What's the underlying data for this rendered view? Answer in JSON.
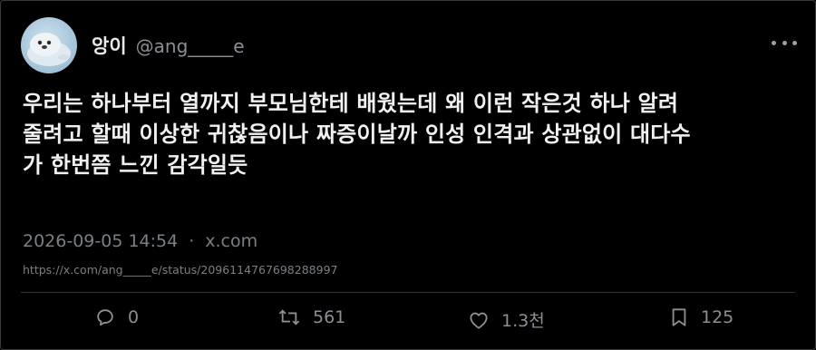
{
  "author": {
    "display_name": "앙이",
    "handle": "@ang_____e"
  },
  "tweet": {
    "lines": [
      "우리는 하나부터 열까지 부모님한테 배웠는데 왜 이런 작은것 하나 알려",
      "줄려고 할때 이상한 귀찮음이나 짜증이날까 인성 인격과 상관없이 대다수",
      "가 한번쯤 느낀 감각일듯"
    ],
    "timestamp": "2026-09-05 14:54",
    "separator": "·",
    "source": "x.com",
    "url": "https://x.com/ang_____e/status/2096114767698288997"
  },
  "actions": {
    "replies": "0",
    "retweets": "561",
    "likes": "1.3천",
    "bookmarks": "125"
  },
  "icons": {
    "more": "more-horizontal-icon",
    "reply": "reply-bubble-icon",
    "retweet": "retweet-icon",
    "like": "heart-icon",
    "bookmark": "bookmark-icon"
  },
  "colors": {
    "background": "#000000",
    "text_primary": "#e7e9ea",
    "text_secondary": "#7a7f84",
    "divider": "#2f3336"
  }
}
